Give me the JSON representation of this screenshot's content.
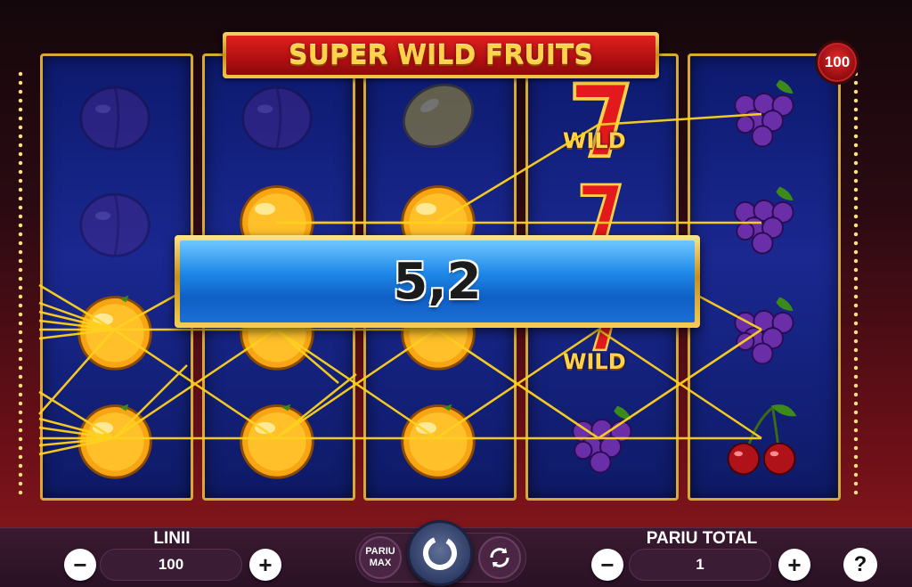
{
  "game": {
    "title": "SUPER WILD FRUITS",
    "lines_badge": "100",
    "win_amount": "5,2",
    "wild_label": "WILD"
  },
  "reels": [
    [
      "plum",
      "plum",
      "orange",
      "orange"
    ],
    [
      "plum",
      "orange",
      "orange",
      "orange"
    ],
    [
      "lemon",
      "orange",
      "orange",
      "orange"
    ],
    [
      "wild-seven",
      "wild-seven",
      "wild-seven",
      "grapes"
    ],
    [
      "grapes",
      "grapes",
      "grapes",
      "cherries"
    ]
  ],
  "controls": {
    "lines_label": "LINII",
    "lines_value": "100",
    "max_bet_line1": "PARIU",
    "max_bet_line2": "MAX",
    "total_bet_label": "PARIU TOTAL",
    "total_bet_value": "1",
    "minus": "−",
    "plus": "+",
    "help": "?"
  },
  "colors": {
    "payline": "#ffd21e",
    "reel_bg": "#1a2890",
    "frame_gold": "#d9a935",
    "banner_red": "#c0141a",
    "win_blue": "#1e88e8"
  }
}
